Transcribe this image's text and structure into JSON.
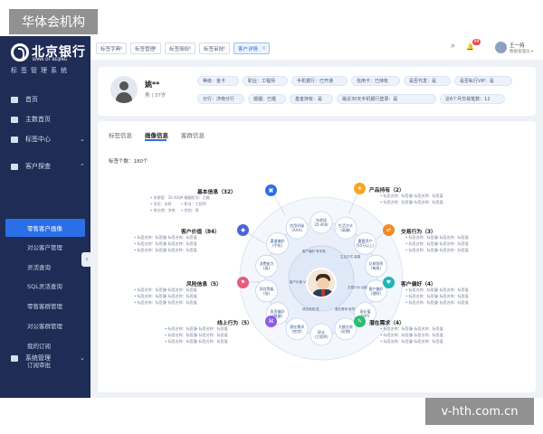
{
  "watermark": {
    "top": "华体会机构",
    "bottom": "v-hth.com.cn"
  },
  "brand": {
    "name_cn": "北京银行",
    "name_en": "BANK OF BEIJING",
    "subtitle": "标签管理系统"
  },
  "sidebar": {
    "items": [
      {
        "label": "首页",
        "icon": "home-icon"
      },
      {
        "label": "主数首页",
        "icon": "dashboard-icon"
      },
      {
        "label": "标签中心",
        "icon": "tag-icon",
        "chevron": "⌄"
      },
      {
        "label": "客户探查",
        "icon": "user-search-icon",
        "chevron": "⌃"
      },
      {
        "label": "系统管理",
        "icon": "settings-icon",
        "chevron": "⌄"
      }
    ],
    "subitems": [
      "零售客户画像",
      "对公客户管理",
      "灵活查询",
      "SQL灵活查询",
      "零售客群管理",
      "对公客群管理",
      "我的订阅",
      "订阅审批"
    ],
    "collapse": "‹"
  },
  "topbar": {
    "tabs": [
      "标签字典",
      "标签管理",
      "标签授权",
      "标签审批",
      "客户详情"
    ],
    "close": "×",
    "search_icon": "⌕",
    "bell_icon": "🔔",
    "badge": "99",
    "user_name": "王一持",
    "user_role": "数据管理员 ▾"
  },
  "profile": {
    "name": "姚**",
    "meta": "男 | 37岁",
    "pills": [
      "等级：金卡",
      "职业：工程师",
      "手机银行：已开通",
      "信用卡：已持有",
      "是否代发：是",
      "是否私行VIP：是",
      "分行：济南分行",
      "婚姻：已婚",
      "基金持有：是",
      "最近30天手机银行登录：是",
      "近6个月交易笔数：12"
    ]
  },
  "content": {
    "subtabs": [
      "标签信息",
      "画像信息",
      "客群信息"
    ],
    "tag_count": "标签个数：180个",
    "categories": [
      {
        "name": "基本信息（32）",
        "color": "#2b6fe8",
        "icon": "▣",
        "tags": [
          "年龄段：35-40岁",
          "婚姻状况：已婚",
          "学历：本科",
          "职业：工程师",
          "所在地：济南",
          "性别：男"
        ]
      },
      {
        "name": "客户价值（84）",
        "color": "#4a67d6",
        "icon": "◆",
        "tags": [
          "标签名称：标签值",
          "标签名称：标签值",
          "标签名称：标签值",
          "标签名称：标签值",
          "标签名称：标签值",
          "标签名称：标签值"
        ]
      },
      {
        "name": "风险信息（5）",
        "color": "#e85b7a",
        "icon": "⚑",
        "tags": [
          "标签名称：标签值",
          "标签名称：标签值",
          "标签名称：标签值",
          "标签名称：标签值",
          "标签名称：标签值",
          "标签名称：标签值"
        ]
      },
      {
        "name": "线上行为（5）",
        "color": "#8e5be8",
        "icon": "⌘",
        "tags": [
          "标签名称：标签值",
          "标签名称：标签值",
          "标签名称：标签值",
          "标签名称：标签值",
          "标签名称：标签值",
          "标签名称：标签值"
        ]
      },
      {
        "name": "产品持有（2）",
        "color": "#f5a623",
        "icon": "★",
        "tags": [
          "标签名称：标签值",
          "标签名称：标签值",
          "标签名称：标签值",
          "标签名称：标签值"
        ]
      },
      {
        "name": "交易行为（3）",
        "color": "#f08a24",
        "icon": "⇄",
        "tags": [
          "标签名称：标签值",
          "标签名称：标签值",
          "标签名称：标签值",
          "标签名称：标签值",
          "标签名称：标签值",
          "标签名称：标签值"
        ]
      },
      {
        "name": "客户偏好（4）",
        "color": "#1fb5b5",
        "icon": "♥",
        "tags": [
          "标签名称：标签值",
          "标签名称：标签值",
          "标签名称：标签值",
          "标签名称：标签值",
          "标签名称：标签值",
          "标签名称：标签值"
        ]
      },
      {
        "name": "潜在需求（4）",
        "color": "#2dbd6e",
        "icon": "✎",
        "tags": [
          "标签名称：标签值",
          "标签名称：标签值",
          "标签名称：标签值",
          "标签名称：标签值",
          "标签名称：标签值",
          "标签名称：标签值"
        ]
      }
    ],
    "ring_nodes": [
      "年龄段\n35-40岁",
      "生活方式\n(高端)",
      "重要资产\n(50万以上)",
      "交易频率\n(每周)",
      "客户偏好\n(理财)",
      "高价值\n(VIP)",
      "大额交易\n(近期)",
      "职业\n(工程师)",
      "潜在需求\n(房贷)",
      "投资偏好\n(稳健)",
      "风险等级\n(低)",
      "消费能力\n(高)",
      "渠道偏好\n(手机)",
      "信用评级\n(AAA)"
    ],
    "inner_notes": [
      "客户偏好·有车族",
      "生活方式·高端",
      "客户价值·VIP",
      "交易行为·活跃",
      "风险信息·低",
      "潜在需求·房贷"
    ]
  }
}
